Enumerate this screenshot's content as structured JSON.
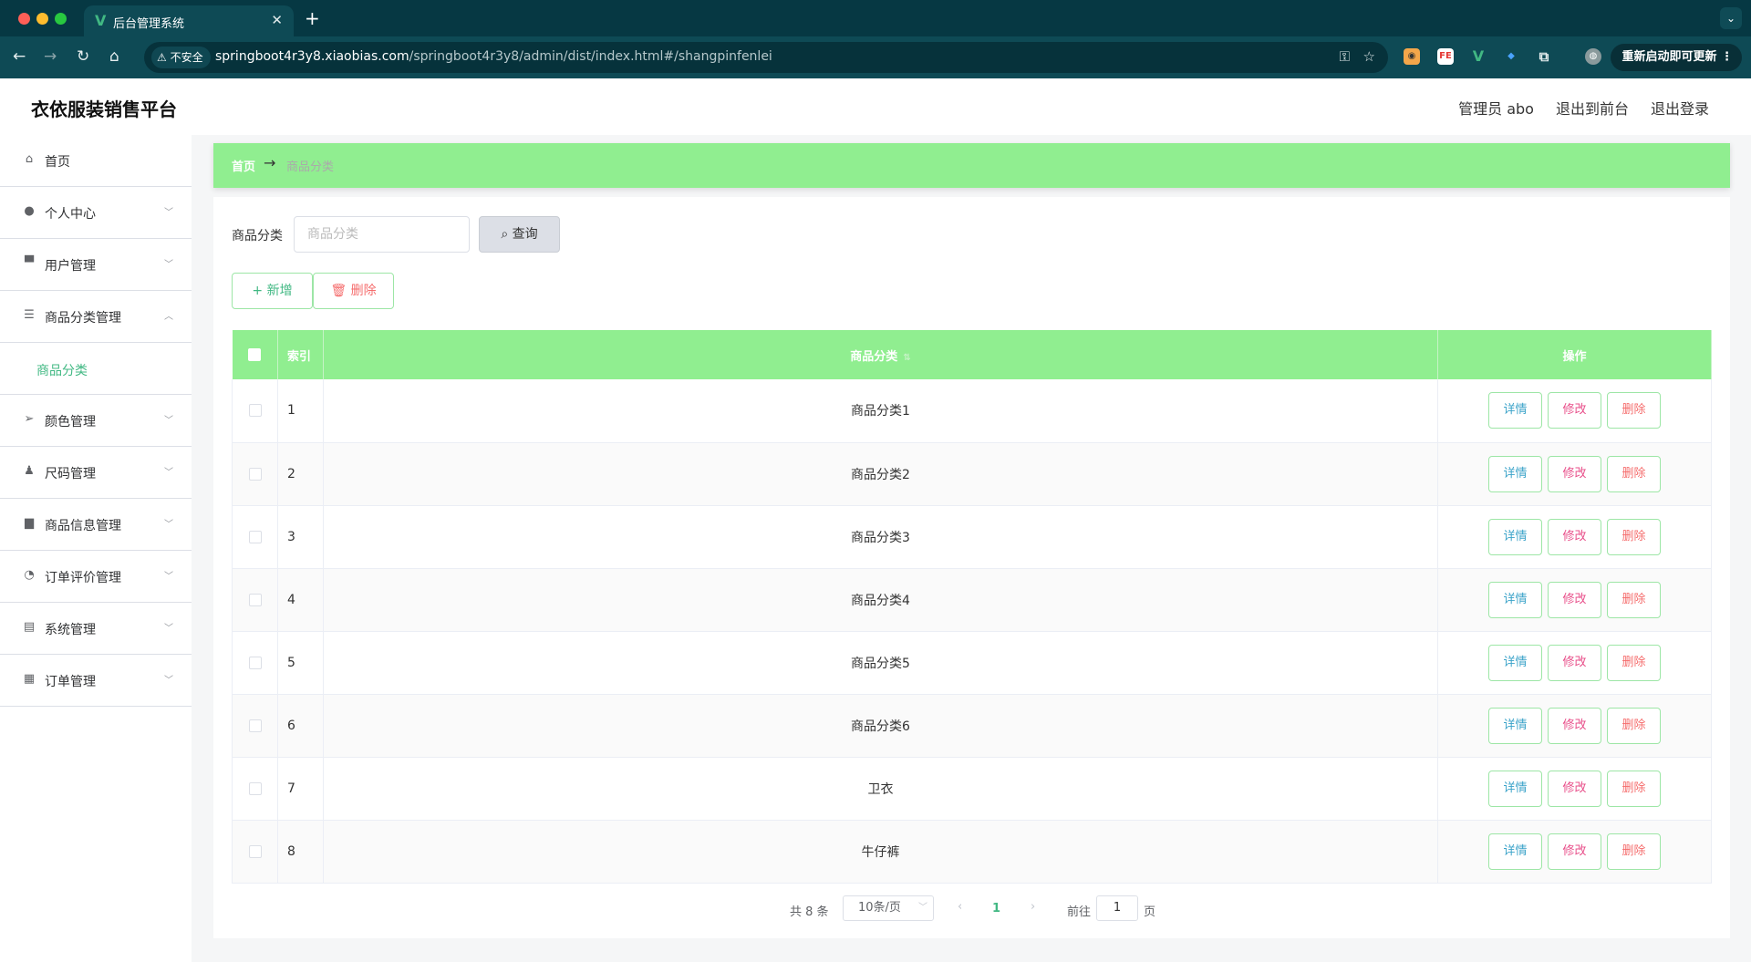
{
  "browser": {
    "tab_title": "后台管理系统",
    "tab_favicon": "V",
    "new_tab": "+",
    "security_label": "不安全",
    "url_host": "springboot4r3y8.xiaobias.com",
    "url_path": "/springboot4r3y8/admin/dist/index.html#/shangpinfenlei",
    "update_button": "重新启动即可更新",
    "extensions": [
      "FE",
      "V"
    ]
  },
  "header": {
    "title": "衣依服装销售平台",
    "user": "管理员 abo",
    "frontend_link": "退出到前台",
    "logout_link": "退出登录"
  },
  "sidebar": {
    "items": [
      {
        "label": "首页",
        "icon": "home-icon"
      },
      {
        "label": "个人中心",
        "icon": "user-icon"
      },
      {
        "label": "用户管理",
        "icon": "users-icon"
      },
      {
        "label": "商品分类管理",
        "icon": "list-icon"
      },
      {
        "label": "颜色管理",
        "icon": "send-icon"
      },
      {
        "label": "尺码管理",
        "icon": "stamp-icon"
      },
      {
        "label": "商品信息管理",
        "icon": "chat-icon"
      },
      {
        "label": "订单评价管理",
        "icon": "gauge-icon"
      },
      {
        "label": "系统管理",
        "icon": "clipboard-icon"
      },
      {
        "label": "订单管理",
        "icon": "grid-icon"
      }
    ],
    "active_sub": "商品分类"
  },
  "breadcrumb": {
    "home": "首页",
    "separator": "→",
    "current": "商品分类"
  },
  "search": {
    "label": "商品分类",
    "placeholder": "商品分类",
    "button": "查询"
  },
  "actions": {
    "add": "新增",
    "delete": "删除"
  },
  "table": {
    "headers": {
      "index": "索引",
      "category": "商品分类",
      "operations": "操作"
    },
    "rows": [
      {
        "index": "1",
        "category": "商品分类1"
      },
      {
        "index": "2",
        "category": "商品分类2"
      },
      {
        "index": "3",
        "category": "商品分类3"
      },
      {
        "index": "4",
        "category": "商品分类4"
      },
      {
        "index": "5",
        "category": "商品分类5"
      },
      {
        "index": "6",
        "category": "商品分类6"
      },
      {
        "index": "7",
        "category": "卫衣"
      },
      {
        "index": "8",
        "category": "牛仔裤"
      }
    ],
    "op_labels": {
      "detail": "详情",
      "edit": "修改",
      "delete": "删除"
    }
  },
  "pagination": {
    "total": "共 8 条",
    "page_size": "10条/页",
    "current_page": "1",
    "jump_label": "前往",
    "jump_value": "1",
    "jump_suffix": "页"
  },
  "colors": {
    "accent": "#90ee90",
    "primary_text": "#41b883",
    "danger": "#f56c6c",
    "browser_chrome": "#0e4a55"
  }
}
